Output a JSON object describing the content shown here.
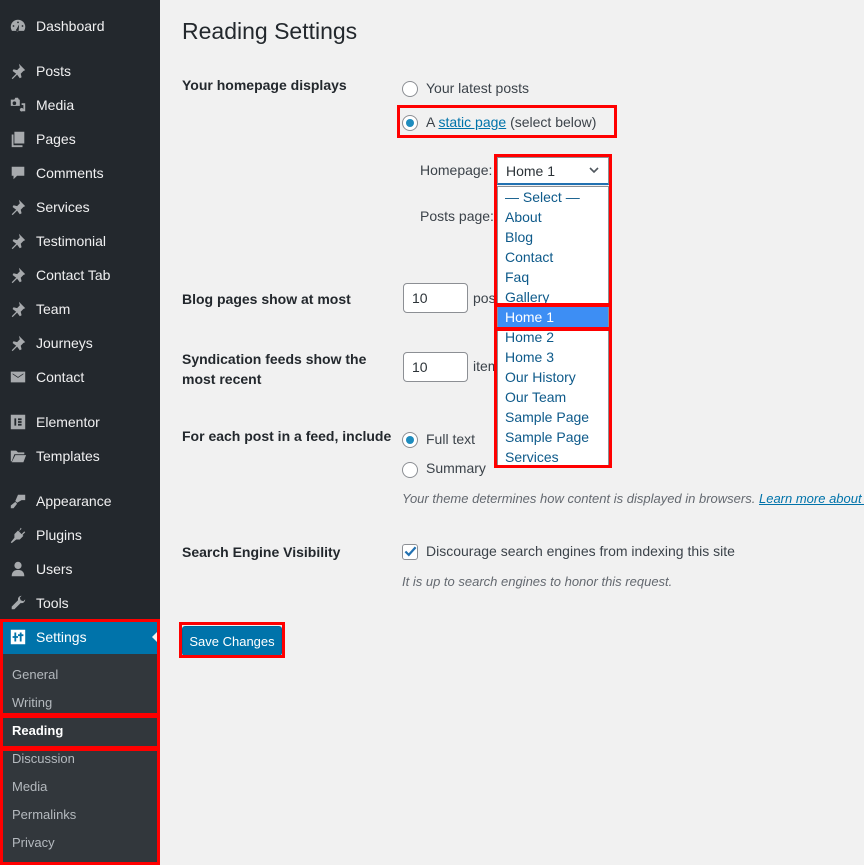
{
  "sidebar": {
    "items": [
      {
        "label": "Dashboard",
        "icon": "dashboard-icon"
      },
      {
        "label": "Posts",
        "icon": "pin-icon"
      },
      {
        "label": "Media",
        "icon": "media-icon"
      },
      {
        "label": "Pages",
        "icon": "pages-icon"
      },
      {
        "label": "Comments",
        "icon": "comment-icon"
      },
      {
        "label": "Services",
        "icon": "pin-icon"
      },
      {
        "label": "Testimonial",
        "icon": "pin-icon"
      },
      {
        "label": "Contact Tab",
        "icon": "pin-icon"
      },
      {
        "label": "Team",
        "icon": "pin-icon"
      },
      {
        "label": "Journeys",
        "icon": "pin-icon"
      },
      {
        "label": "Contact",
        "icon": "envelope-icon"
      },
      {
        "label": "Elementor",
        "icon": "elementor-icon"
      },
      {
        "label": "Templates",
        "icon": "folder-icon"
      },
      {
        "label": "Appearance",
        "icon": "paintbrush-icon"
      },
      {
        "label": "Plugins",
        "icon": "plugin-icon"
      },
      {
        "label": "Users",
        "icon": "user-icon"
      },
      {
        "label": "Tools",
        "icon": "wrench-icon"
      },
      {
        "label": "Settings",
        "icon": "settings-icon",
        "active": true
      }
    ],
    "submenu": [
      {
        "label": "General"
      },
      {
        "label": "Writing"
      },
      {
        "label": "Reading",
        "current": true
      },
      {
        "label": "Discussion"
      },
      {
        "label": "Media"
      },
      {
        "label": "Permalinks"
      },
      {
        "label": "Privacy"
      }
    ]
  },
  "page": {
    "title": "Reading Settings",
    "homepage_displays": {
      "label": "Your homepage displays",
      "option_latest": "Your latest posts",
      "option_static_prefix": "A",
      "option_static_link": "static page",
      "option_static_suffix": "(select below)",
      "selected": "static page"
    },
    "homepage_select": {
      "label": "Homepage:",
      "value": "Home 1",
      "options": [
        "— Select —",
        "About",
        "Blog",
        "Contact",
        "Faq",
        "Gallery",
        "Home 1",
        "Home 2",
        "Home 3",
        "Our History",
        "Our Team",
        "Sample Page",
        "Sample Page",
        "Services"
      ],
      "highlighted": "Home 1"
    },
    "posts_page": {
      "label": "Posts page:"
    },
    "blog_pages": {
      "label": "Blog pages show at most",
      "value": "10",
      "unit": "posts"
    },
    "syndication": {
      "label_line1": "Syndication feeds show the",
      "label_line2": "most recent",
      "value": "10",
      "unit": "items"
    },
    "feed_include": {
      "label": "For each post in a feed, include",
      "option_full": "Full text",
      "option_summary": "Summary",
      "selected": "Full text",
      "description": "Your theme determines how content is displayed in browsers.",
      "learn_more": "Learn more about feeds"
    },
    "search_visibility": {
      "label": "Search Engine Visibility",
      "checkbox_label": "Discourage search engines from indexing this site",
      "checked": true,
      "description": "It is up to search engines to honor this request."
    },
    "save_button": "Save Changes"
  },
  "colors": {
    "sidebar_bg": "#23282d",
    "submenu_bg": "#32373c",
    "accent": "#0073aa",
    "highlight": "#ff0000",
    "dropdown_selected": "#3d8ef4"
  }
}
